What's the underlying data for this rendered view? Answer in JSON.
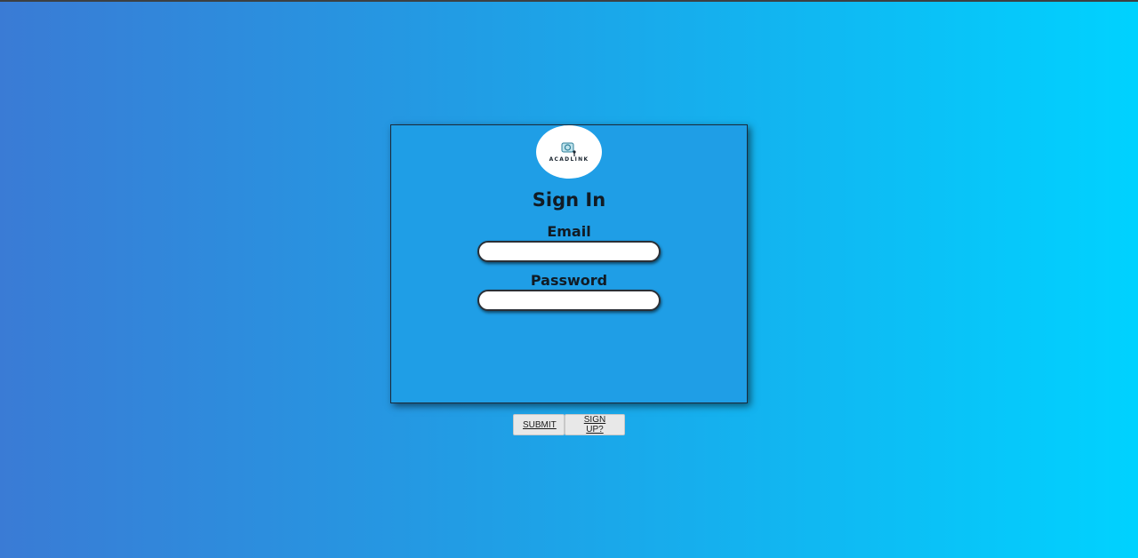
{
  "logo": {
    "text": "ACADLINK",
    "icon": "acadlink-logo-icon"
  },
  "form": {
    "title": "Sign In",
    "email_label": "Email",
    "email_value": "",
    "password_label": "Password",
    "password_value": ""
  },
  "actions": {
    "submit_label": "SUBMIT",
    "signup_label": "SIGN UP?"
  },
  "colors": {
    "background_start": "#3a7bd5",
    "background_end": "#00d2ff",
    "card": "#1f9ee6",
    "text": "#111b24"
  }
}
